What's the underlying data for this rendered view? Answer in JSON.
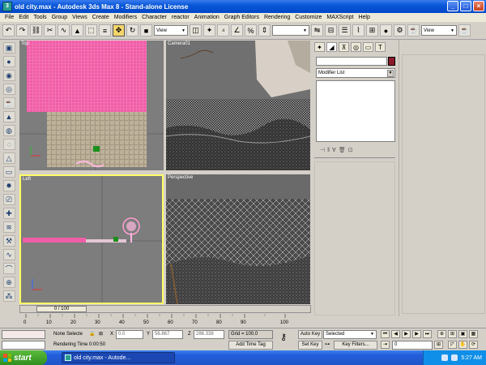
{
  "window": {
    "title": "old city.max - Autodesk 3ds Max 8  -  Stand-alone License",
    "app_icon": "3ds-max-icon",
    "minimize": "_",
    "maximize": "□",
    "close": "×"
  },
  "menu": [
    "File",
    "Edit",
    "Tools",
    "Group",
    "Views",
    "Create",
    "Modifiers",
    "Character",
    "reactor",
    "Animation",
    "Graph Editors",
    "Rendering",
    "Customize",
    "MAXScript",
    "Help"
  ],
  "toolbar": {
    "refcoord_1": "View",
    "refcoord_2": "View",
    "named_selection": ""
  },
  "viewports": {
    "top": "Top",
    "camera": "Camera01",
    "left": "Left",
    "perspective": "Perspective"
  },
  "command_panel": {
    "name_field": "",
    "object_color": "#8b1a2a",
    "modifier_list": "Modifier List"
  },
  "time": {
    "slider": "0 / 100",
    "ticks": [
      "0",
      "10",
      "20",
      "30",
      "40",
      "50",
      "60",
      "70",
      "80",
      "90",
      "100"
    ]
  },
  "status": {
    "selection": "None Selecte",
    "x_label": "X",
    "x_value": "0.0",
    "y_label": "Y",
    "y_value": "56.867",
    "z_label": "Z",
    "z_value": "286.338",
    "grid": "Grid = 100.0",
    "auto_key": "Auto Key",
    "selected_dropdown": "Selected",
    "set_key": "Set Key",
    "key_filters": "Key Filters...",
    "rendering_time": "Rendering Time  0:00:50",
    "add_time_tag": "Add Time Tag",
    "frame": "0"
  },
  "taskbar": {
    "start": "start",
    "task": "old city.max - Autode...",
    "clock": "5:27 AM"
  }
}
